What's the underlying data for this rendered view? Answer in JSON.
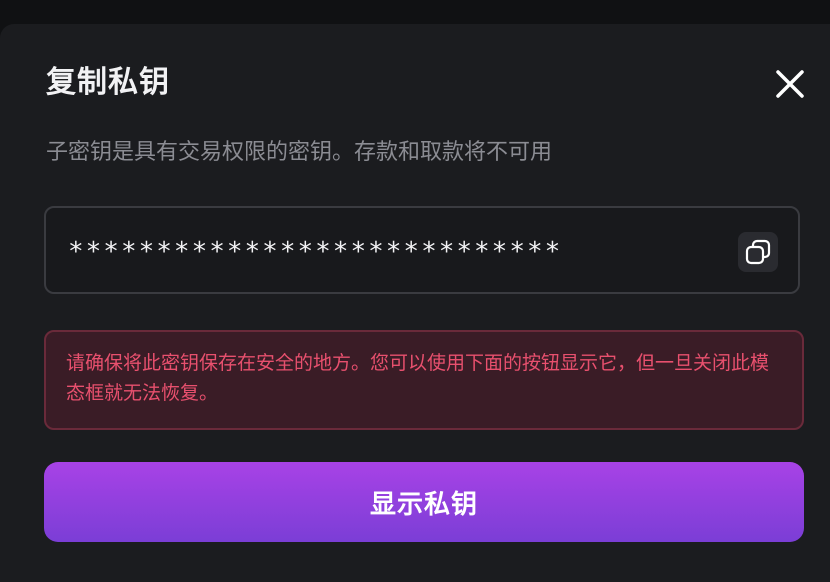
{
  "modal": {
    "title": "复制私钥",
    "close_icon": "close-icon",
    "subtitle": "子密钥是具有交易权限的密钥。存款和取款将不可用",
    "key_field": {
      "masked_value": "****************************",
      "copy_icon": "copy-icon"
    },
    "warning": {
      "text": "请确保将此密钥保存在安全的地方。您可以使用下面的按钮显示它，但一旦关闭此模态框就无法恢复。"
    },
    "reveal_button": {
      "label": "显示私钥"
    }
  },
  "colors": {
    "background": "#101113",
    "modal_bg": "#1b1c1f",
    "title": "#f2f2f4",
    "subtitle": "#8b8c93",
    "warning_text": "#e8506e",
    "warning_bg": "#3a1c26",
    "warning_border": "#6a2a3a",
    "button_gradient_top": "#a842e6",
    "button_gradient_bottom": "#7b3ed6"
  }
}
